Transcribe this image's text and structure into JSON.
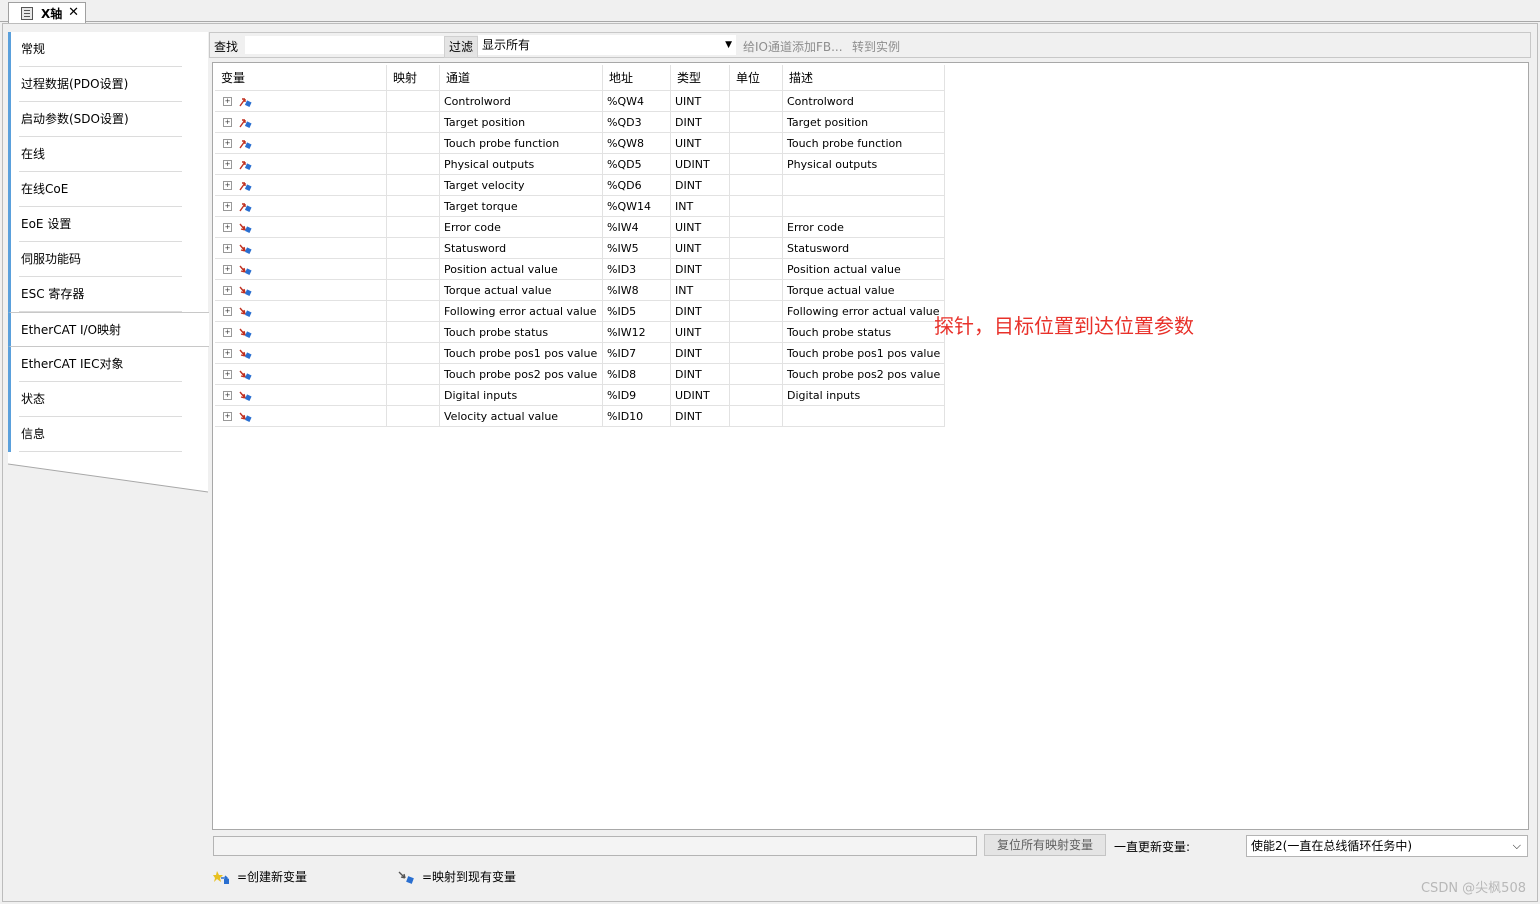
{
  "tab": {
    "title": "X轴",
    "close": "✕"
  },
  "sidenav": {
    "items": [
      {
        "label": "常规"
      },
      {
        "label": "过程数据(PDO设置)"
      },
      {
        "label": "启动参数(SDO设置)"
      },
      {
        "label": "在线"
      },
      {
        "label": "在线CoE"
      },
      {
        "label": "EoE 设置"
      },
      {
        "label": "伺服功能码"
      },
      {
        "label": "ESC 寄存器"
      },
      {
        "label": "EtherCAT I/O映射"
      },
      {
        "label": "EtherCAT IEC对象"
      },
      {
        "label": "状态"
      },
      {
        "label": "信息"
      }
    ],
    "active_index": 8
  },
  "toolbar": {
    "find_label": "查找",
    "find_value": "",
    "filter_label": "过滤",
    "filter_value": "显示所有",
    "add_fb_label": "给IO通道添加FB...",
    "goto_label": "转到实例"
  },
  "table": {
    "headers": [
      "变量",
      "映射",
      "通道",
      "地址",
      "类型",
      "单位",
      "描述"
    ],
    "rows": [
      {
        "channel": "Controlword",
        "address": "%QW4",
        "type": "UINT",
        "desc": "Controlword",
        "dir": "out"
      },
      {
        "channel": "Target position",
        "address": "%QD3",
        "type": "DINT",
        "desc": "Target position",
        "dir": "out"
      },
      {
        "channel": "Touch probe function",
        "address": "%QW8",
        "type": "UINT",
        "desc": "Touch probe function",
        "dir": "out"
      },
      {
        "channel": "Physical outputs",
        "address": "%QD5",
        "type": "UDINT",
        "desc": "Physical outputs",
        "dir": "out"
      },
      {
        "channel": "Target velocity",
        "address": "%QD6",
        "type": "DINT",
        "desc": "",
        "dir": "out"
      },
      {
        "channel": "Target torque",
        "address": "%QW14",
        "type": "INT",
        "desc": "",
        "dir": "out"
      },
      {
        "channel": "Error code",
        "address": "%IW4",
        "type": "UINT",
        "desc": "Error code",
        "dir": "in"
      },
      {
        "channel": "Statusword",
        "address": "%IW5",
        "type": "UINT",
        "desc": "Statusword",
        "dir": "in"
      },
      {
        "channel": "Position actual value",
        "address": "%ID3",
        "type": "DINT",
        "desc": "Position actual value",
        "dir": "in"
      },
      {
        "channel": "Torque actual value",
        "address": "%IW8",
        "type": "INT",
        "desc": "Torque actual value",
        "dir": "in"
      },
      {
        "channel": "Following error actual value",
        "address": "%ID5",
        "type": "DINT",
        "desc": "Following error actual value",
        "dir": "in"
      },
      {
        "channel": "Touch probe status",
        "address": "%IW12",
        "type": "UINT",
        "desc": "Touch probe status",
        "dir": "in"
      },
      {
        "channel": "Touch probe pos1 pos value",
        "address": "%ID7",
        "type": "DINT",
        "desc": "Touch probe pos1 pos value",
        "dir": "in"
      },
      {
        "channel": "Touch probe pos2 pos value",
        "address": "%ID8",
        "type": "DINT",
        "desc": "Touch probe pos2 pos value",
        "dir": "in"
      },
      {
        "channel": "Digital inputs",
        "address": "%ID9",
        "type": "UDINT",
        "desc": "Digital inputs",
        "dir": "in"
      },
      {
        "channel": "Velocity actual value",
        "address": "%ID10",
        "type": "DINT",
        "desc": "",
        "dir": "in"
      }
    ]
  },
  "annotation": "探针，目标位置到达位置参数",
  "bottom": {
    "reset_label": "复位所有映射变量",
    "update_label": "一直更新变量:",
    "update_value": "使能2(一直在总线循环任务中)"
  },
  "legend": {
    "new_var": "=创建新变量",
    "map_existing": "=映射到现有变量"
  },
  "watermark": "CSDN @尖枫508",
  "colors": {
    "accent_nav": "#5aa0dc",
    "annotation": "#e8312a",
    "icon_out": "#c03020",
    "icon_in": "#c03020",
    "icon_blue": "#2a6fd0"
  }
}
